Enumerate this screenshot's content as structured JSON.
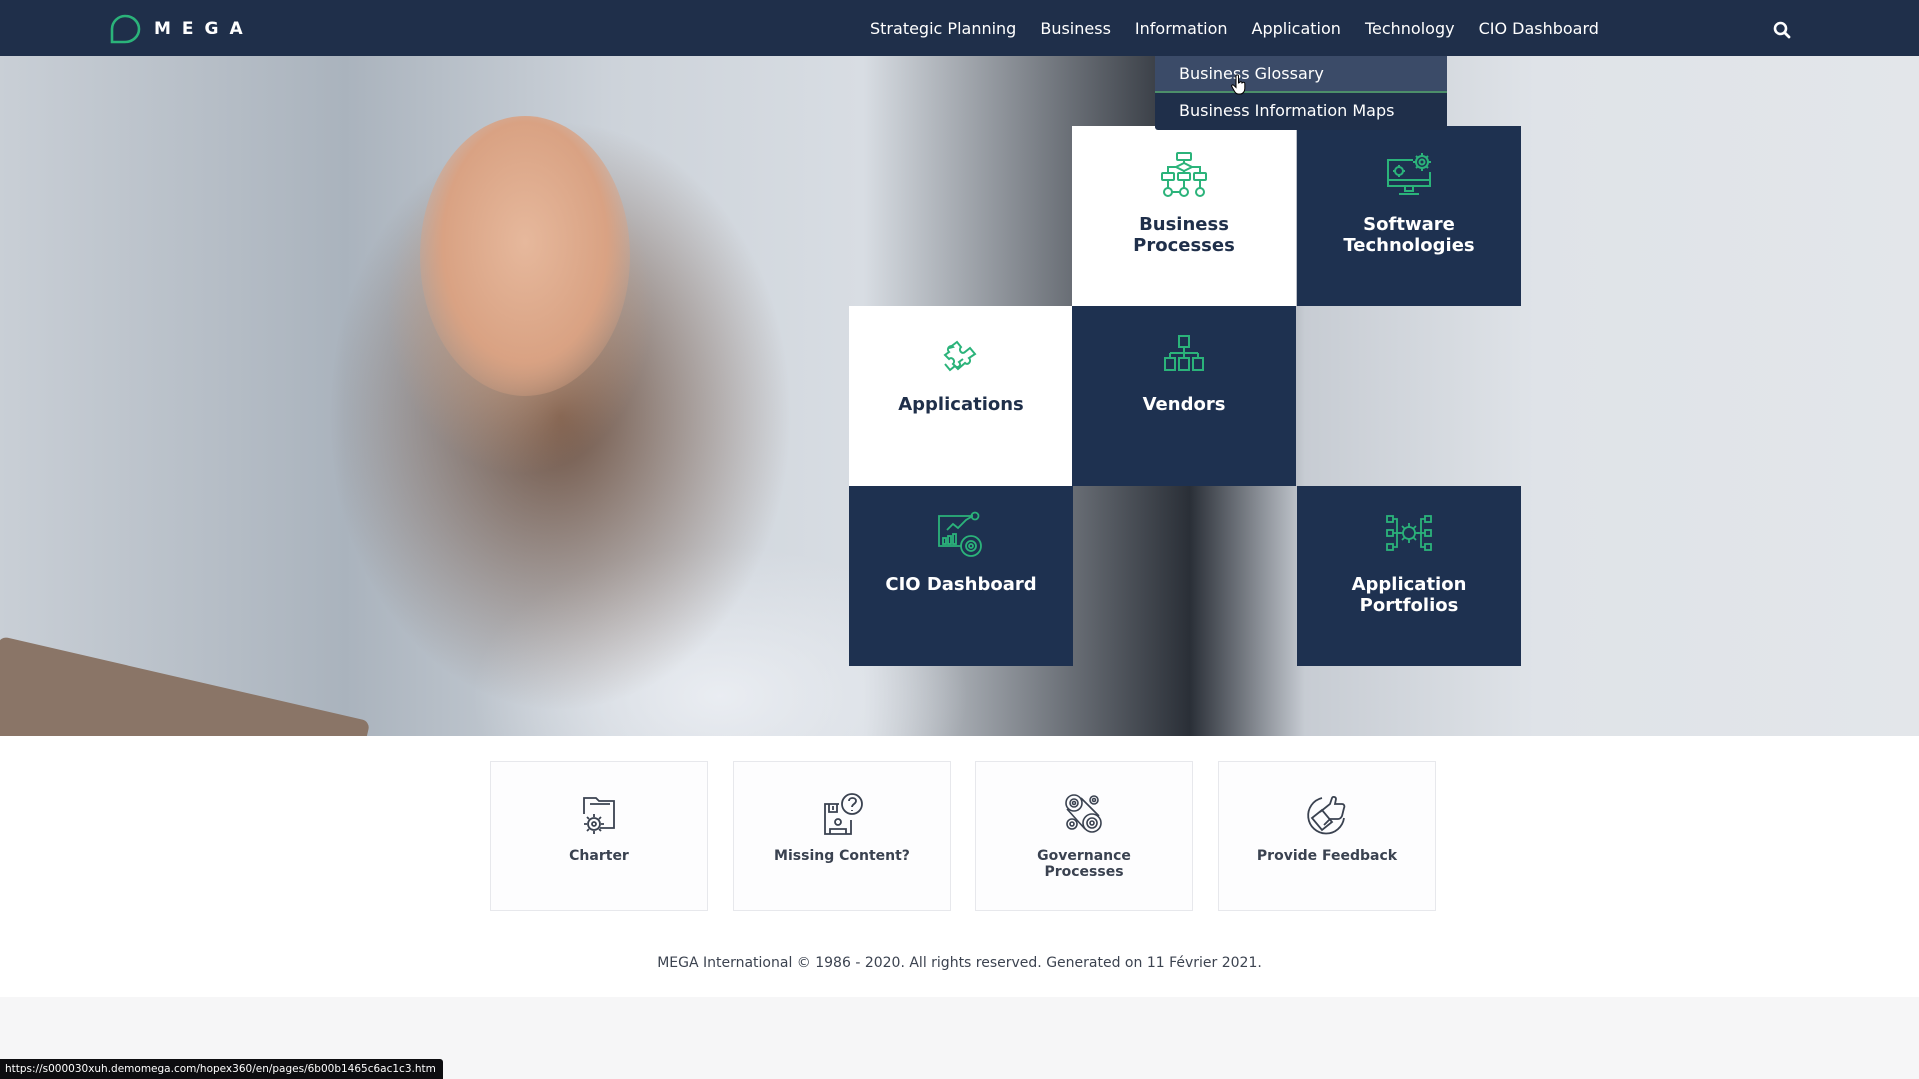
{
  "header": {
    "logo_text": "MEGA",
    "nav": [
      {
        "label": "Strategic Planning"
      },
      {
        "label": "Business"
      },
      {
        "label": "Information"
      },
      {
        "label": "Application"
      },
      {
        "label": "Technology"
      },
      {
        "label": "CIO Dashboard"
      }
    ],
    "search_icon": "search-icon"
  },
  "dropdown": {
    "parent": "Information",
    "items": [
      {
        "label": "Business Glossary",
        "hovered": true
      },
      {
        "label": "Business Information Maps",
        "hovered": false
      }
    ]
  },
  "tiles": [
    {
      "label": "Business Processes",
      "icon": "flowchart-icon",
      "theme": "light"
    },
    {
      "label": "Software Technologies",
      "icon": "monitor-gears-icon",
      "theme": "dark"
    },
    {
      "label": "Applications",
      "icon": "puzzle-icon",
      "theme": "light"
    },
    {
      "label": "Vendors",
      "icon": "org-chart-icon",
      "theme": "dark"
    },
    {
      "label": "CIO Dashboard",
      "icon": "dashboard-chart-icon",
      "theme": "dark"
    },
    {
      "label": "Application Portfolios",
      "icon": "gear-network-icon",
      "theme": "dark"
    }
  ],
  "cards": [
    {
      "label": "Charter",
      "icon": "folder-gear-icon"
    },
    {
      "label": "Missing Content?",
      "icon": "disk-question-icon"
    },
    {
      "label": "Governance Processes",
      "icon": "gears-icon"
    },
    {
      "label": "Provide Feedback",
      "icon": "thumbs-up-icon"
    }
  ],
  "footer": {
    "copyright": "MEGA International © 1986 - 2020. All rights reserved. Generated on 11 Février 2021."
  },
  "status_bar": {
    "url": "https://s000030xuh.demomega.com/hopex360/en/pages/6b00b1465c6ac1c3.htm"
  },
  "colors": {
    "navbar": "#1f2f4a",
    "tile_dark": "#1e3150",
    "accent_green": "#2bb37a",
    "dropdown_hover": "#3b4b68"
  }
}
